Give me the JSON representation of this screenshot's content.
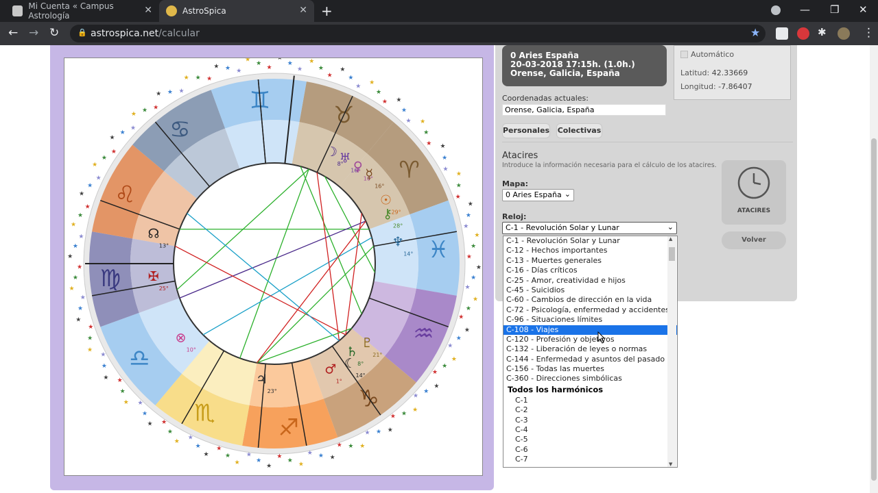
{
  "browser": {
    "tabs": [
      {
        "title": "Mi Cuenta « Campus Astrología",
        "active": false
      },
      {
        "title": "AstroSpica",
        "active": true
      }
    ],
    "url_host": "astrospica.net",
    "url_path": "/calcular"
  },
  "chart_card": {
    "name": "0 Aries España",
    "datetime": "20-03-2018 17:15h. (1.0h.)",
    "place": "Orense, Galicia, España"
  },
  "coords": {
    "auto_label": "Automático",
    "lat_label": "Latitud:",
    "lat_value": "42.33669",
    "lon_label": "Longitud:",
    "lon_value": "-7.86407"
  },
  "current": {
    "label": "Coordenadas actuales:",
    "value": "Orense, Galicia, España"
  },
  "buttons": {
    "personales": "Personales",
    "colectivas": "Colectivas",
    "atacires": "ATACIRES",
    "volver": "Volver"
  },
  "atacires": {
    "title": "Atacires",
    "desc": "Introduce la información necesaria para el cálculo de los atacires.",
    "mapa_label": "Mapa:",
    "mapa_value": "0 Aries España",
    "reloj_label": "Reloj:",
    "reloj_value": "C-1 - Revolución Solar y Lunar"
  },
  "dropdown": {
    "options": [
      "C-1 - Revolución Solar y Lunar",
      "C-12 - Hechos importantes",
      "C-13 - Muertes generales",
      "C-16 - Días críticos",
      "C-25 - Amor, creatividad e hijos",
      "C-45 - Suicidios",
      "C-60 - Cambios de dirección en la vida",
      "C-72 - Psicología, enfermedad y accidentes",
      "C-96 - Situaciones límites",
      "C-108 - Viajes",
      "C-120 - Profesión y objetivos",
      "C-132 - Liberación de leyes o normas",
      "C-144 - Enfermedad y asuntos del pasado",
      "C-156 - Todas las muertes",
      "C-360 - Direcciones simbólicas"
    ],
    "selected_index": 9,
    "group_label": "Todos los harmónicos",
    "harmonics": [
      "C-1",
      "C-2",
      "C-3",
      "C-4",
      "C-5",
      "C-6",
      "C-7"
    ]
  },
  "wheel": {
    "signs": [
      {
        "glyph": "♉",
        "color": "#b59c7e",
        "inner": "#d6c6ae",
        "ink": "#7a5a30"
      },
      {
        "glyph": "♈",
        "color": "#b59c7e",
        "inner": "#d6c6ae",
        "ink": "#7a5a30"
      },
      {
        "glyph": "♓",
        "color": "#a6cdf0",
        "inner": "#cfe4f8",
        "ink": "#3d86c6"
      },
      {
        "glyph": "♒",
        "color": "#a989c9",
        "inner": "#cdb8e0",
        "ink": "#6a3fa0"
      },
      {
        "glyph": "♑",
        "color": "#c9a27c",
        "inner": "#e2c8ae",
        "ink": "#7a4a20"
      },
      {
        "glyph": "♐",
        "color": "#f7a15c",
        "inner": "#fbc99c",
        "ink": "#c8661b"
      },
      {
        "glyph": "♏",
        "color": "#f8dd8a",
        "inner": "#fbeebf",
        "ink": "#c79c19"
      },
      {
        "glyph": "♎",
        "color": "#a6cdf0",
        "inner": "#cfe4f8",
        "ink": "#3d86c6"
      },
      {
        "glyph": "♍",
        "color": "#8f8fb9",
        "inner": "#bdbdd8",
        "ink": "#3a3a80"
      },
      {
        "glyph": "♌",
        "color": "#e39566",
        "inner": "#efc4a6",
        "ink": "#b04a18"
      },
      {
        "glyph": "♋",
        "color": "#8c9db5",
        "inner": "#bcc8d8",
        "ink": "#3d5a80"
      },
      {
        "glyph": "♊",
        "color": "#a6cdf0",
        "inner": "#cfe4f8",
        "ink": "#3d86c6"
      }
    ],
    "planets": [
      {
        "glyph": "♅",
        "deg": "16°",
        "color": "#6a3fa0"
      },
      {
        "glyph": "♀",
        "deg": "16°",
        "color": "#a04a9a"
      },
      {
        "glyph": "☿",
        "deg": "16°",
        "color": "#7a4a20"
      },
      {
        "glyph": "☽",
        "deg": "8°",
        "color": "#4a2a8a"
      },
      {
        "glyph": "☉",
        "deg": "29°",
        "color": "#c8661b"
      },
      {
        "glyph": "⚷",
        "deg": "28°",
        "color": "#4a8a2a"
      },
      {
        "glyph": "♆",
        "deg": "14°",
        "color": "#2a6a9a"
      },
      {
        "glyph": "♇",
        "deg": "21°",
        "color": "#8a6a20"
      },
      {
        "glyph": "♄",
        "deg": "8°",
        "color": "#2a6a2a"
      },
      {
        "glyph": "☾",
        "deg": "14°",
        "color": "#222"
      },
      {
        "glyph": "♂",
        "deg": "1°",
        "color": "#b02020"
      },
      {
        "glyph": "♃",
        "deg": "23°",
        "color": "#333"
      },
      {
        "glyph": "⊗",
        "deg": "10°",
        "color": "#c83a8a"
      },
      {
        "glyph": "✠",
        "deg": "25°",
        "color": "#b02020"
      },
      {
        "glyph": "☊",
        "deg": "13°",
        "color": "#222"
      }
    ]
  }
}
